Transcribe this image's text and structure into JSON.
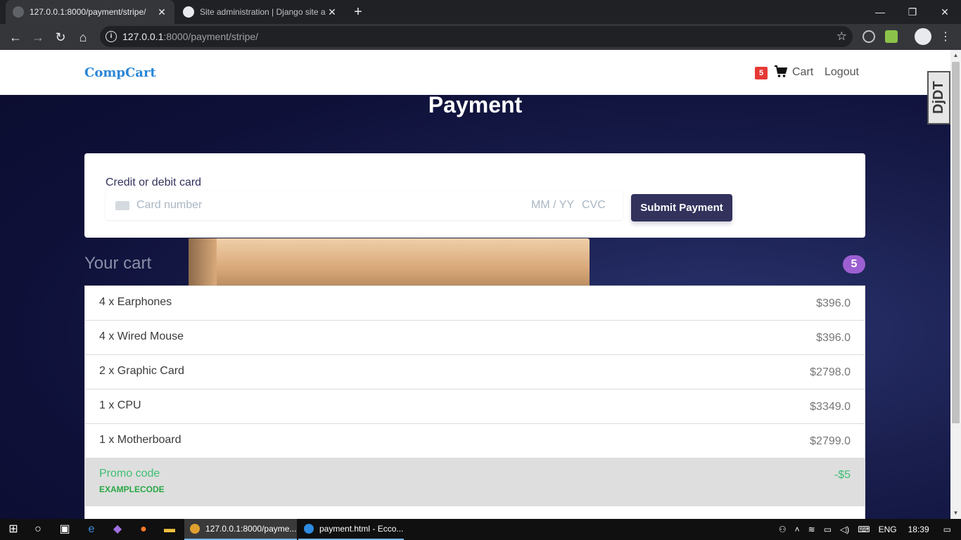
{
  "browser": {
    "tabs": [
      {
        "title": "127.0.0.1:8000/payment/stripe/",
        "active": true
      },
      {
        "title": "Site administration | Django site a",
        "active": false
      }
    ],
    "url_host": "127.0.0.1",
    "url_rest": ":8000/payment/stripe/"
  },
  "navbar": {
    "brand": "CompCart",
    "cart_badge": "5",
    "cart_label": "Cart",
    "logout_label": "Logout",
    "debug_toolbar": "DjDT"
  },
  "page": {
    "title": "Payment"
  },
  "payment_form": {
    "label": "Credit or debit card",
    "card_number_placeholder": "Card number",
    "expiry_placeholder": "MM / YY",
    "cvc_placeholder": "CVC",
    "submit_label": "Submit Payment"
  },
  "cart": {
    "heading": "Your cart",
    "count": "5",
    "items": [
      {
        "name": "4 x Earphones",
        "price": "$396.0"
      },
      {
        "name": "4 x Wired Mouse",
        "price": "$396.0"
      },
      {
        "name": "2 x Graphic Card",
        "price": "$2798.0"
      },
      {
        "name": "1 x CPU",
        "price": "$3349.0"
      },
      {
        "name": "1 x Motherboard",
        "price": "$2799.0"
      }
    ],
    "promo": {
      "label": "Promo code",
      "code": "EXAMPLECODE",
      "amount": "-$5"
    }
  },
  "taskbar": {
    "tasks": [
      {
        "label": "127.0.0.1:8000/payme..."
      },
      {
        "label": "payment.html - Ecco..."
      }
    ],
    "language": "ENG",
    "time": "18:39"
  },
  "colors": {
    "brand": "#2a86d6",
    "submit_button": "#32325d",
    "cart_count_badge": "#9c5fd1",
    "cart_badge": "#e53935",
    "promo_text": "#3bbf73"
  }
}
